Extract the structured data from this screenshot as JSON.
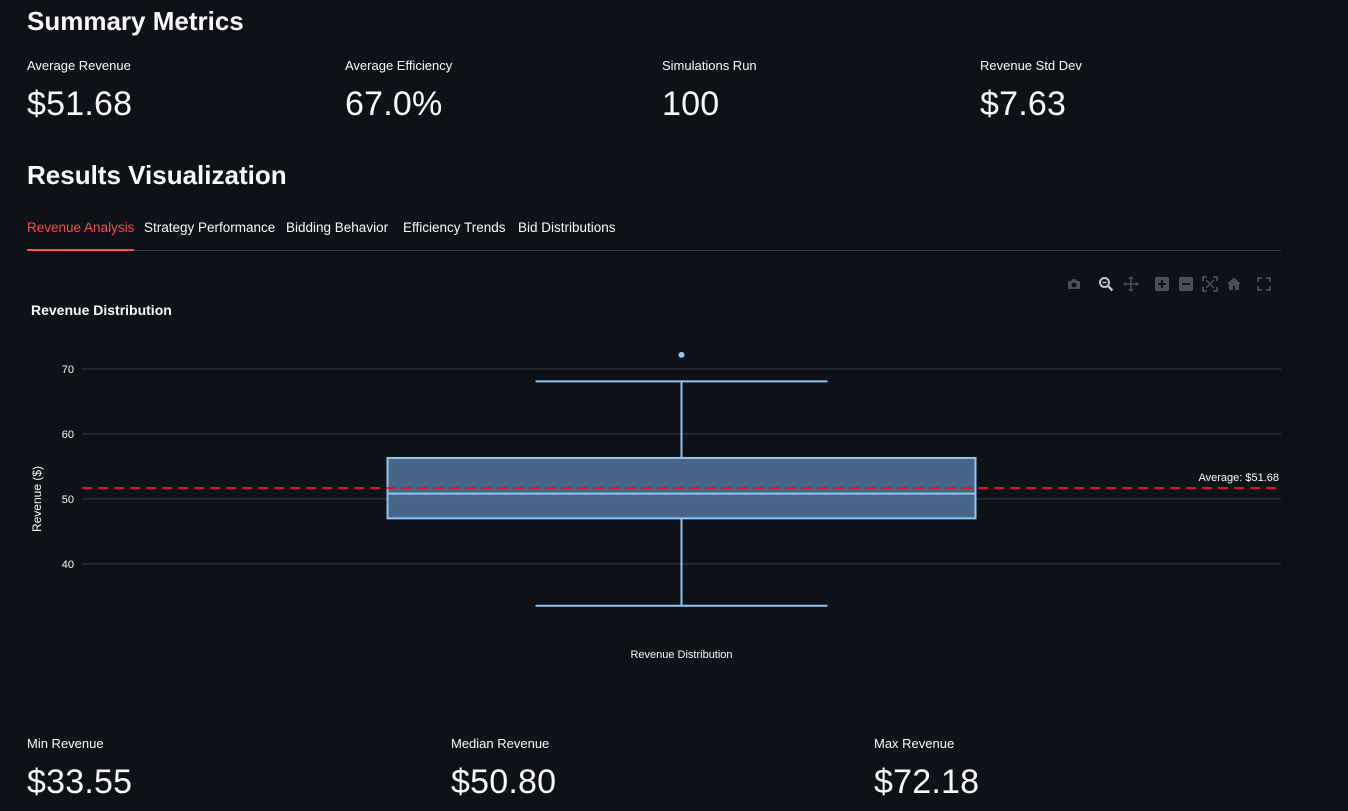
{
  "summary": {
    "title": "Summary Metrics",
    "metrics": [
      {
        "label": "Average Revenue",
        "value": "$51.68"
      },
      {
        "label": "Average Efficiency",
        "value": "67.0%"
      },
      {
        "label": "Simulations Run",
        "value": "100"
      },
      {
        "label": "Revenue Std Dev",
        "value": "$7.63"
      }
    ]
  },
  "results": {
    "title": "Results Visualization",
    "tabs": [
      "Revenue Analysis",
      "Strategy Performance",
      "Bidding Behavior",
      "Efficiency Trends",
      "Bid Distributions"
    ],
    "active_tab": "Revenue Analysis"
  },
  "modebar": {
    "icons": [
      "camera-icon",
      "zoom-icon",
      "pan-icon",
      "zoom-in-icon",
      "zoom-out-icon",
      "autoscale-icon",
      "reset-axes-icon",
      "fullscreen-icon"
    ]
  },
  "chart_data": {
    "type": "box",
    "title": "Revenue Distribution",
    "ylabel": "Revenue ($)",
    "xlabel": "",
    "categories": [
      "Revenue Distribution"
    ],
    "yticks": [
      40,
      50,
      60,
      70
    ],
    "ylim": [
      27.5,
      74
    ],
    "grid": true,
    "box": {
      "name": "Revenue Distribution",
      "min": 33.55,
      "q1": 47.0,
      "median": 50.8,
      "q3": 56.3,
      "upper_whisker": 68.1,
      "outliers": [
        72.18
      ]
    },
    "reference_line": {
      "value": 51.68,
      "label": "Average: $51.68",
      "color": "#e0151f"
    },
    "colors": {
      "box_line": "#8ec5f4",
      "box_fill": "#4b6d91",
      "grid": "#3a3d45"
    }
  },
  "bottom_metrics": [
    {
      "label": "Min Revenue",
      "value": "$33.55"
    },
    {
      "label": "Median Revenue",
      "value": "$50.80"
    },
    {
      "label": "Max Revenue",
      "value": "$72.18"
    }
  ]
}
